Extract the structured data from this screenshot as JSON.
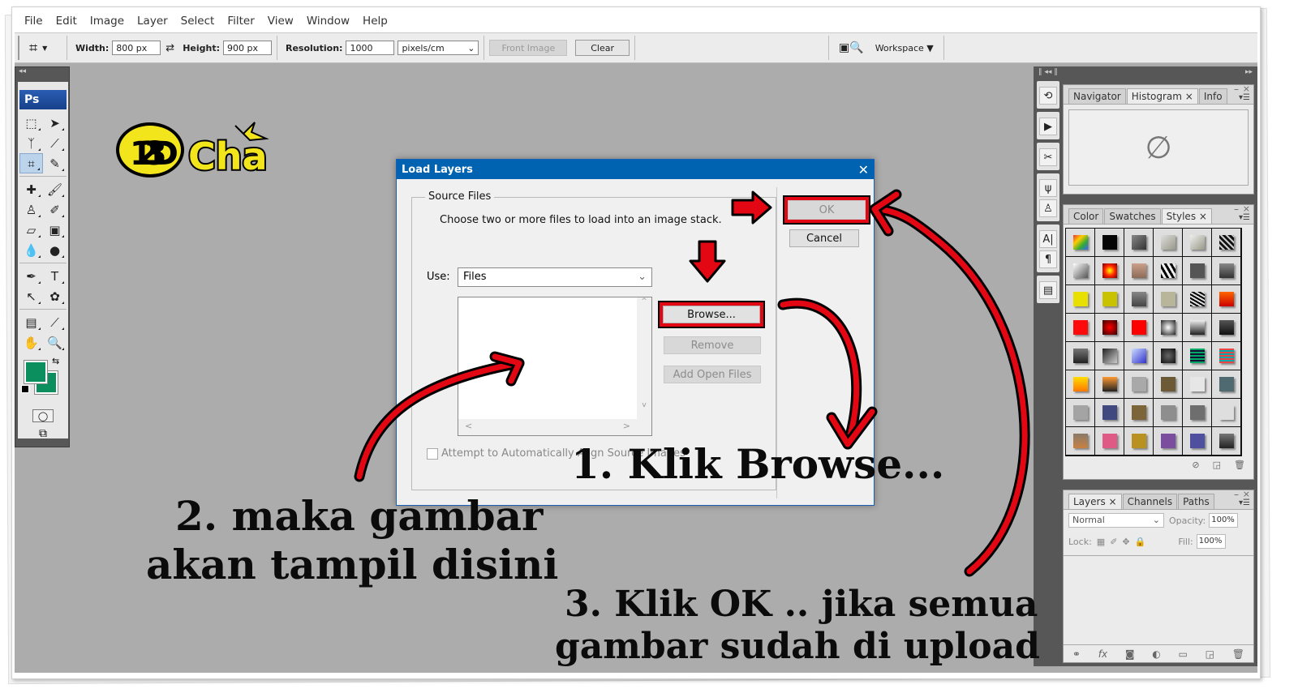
{
  "menubar": {
    "items": [
      "File",
      "Edit",
      "Image",
      "Layer",
      "Select",
      "Filter",
      "View",
      "Window",
      "Help"
    ]
  },
  "options_bar": {
    "tool_icon": "crop-icon",
    "width_label": "Width:",
    "width_value": "800 px",
    "swap_icon": "swap-arrows-icon",
    "height_label": "Height:",
    "height_value": "900 px",
    "resolution_label": "Resolution:",
    "resolution_value": "1000",
    "resolution_unit": "pixels/cm",
    "front_image_label": "Front Image",
    "clear_label": "Clear",
    "bridge_icon": "bridge-search-icon",
    "workspace_label": "Workspace ▼"
  },
  "tools_panel": {
    "collapse": "◂◂",
    "logo": "Ps",
    "foreground_color": "#0c8f5e",
    "background_color": "#0c8f5e",
    "tools": [
      {
        "name": "marquee-tool-icon",
        "glyph": "⬚"
      },
      {
        "name": "move-tool-icon",
        "glyph": "➤"
      },
      {
        "name": "lasso-tool-icon",
        "glyph": "ᛉ"
      },
      {
        "name": "quick-selection-tool-icon",
        "glyph": "⟋"
      },
      {
        "name": "crop-tool-icon",
        "glyph": "⌗",
        "active": true
      },
      {
        "name": "eyedropper-slice-tool-icon",
        "glyph": "✎"
      },
      {
        "name": "healing-brush-tool-icon",
        "glyph": "✚"
      },
      {
        "name": "brush-tool-icon",
        "glyph": "🖌"
      },
      {
        "name": "clone-stamp-tool-icon",
        "glyph": "♙"
      },
      {
        "name": "history-brush-tool-icon",
        "glyph": "✐"
      },
      {
        "name": "eraser-tool-icon",
        "glyph": "▱"
      },
      {
        "name": "gradient-tool-icon",
        "glyph": "▣"
      },
      {
        "name": "blur-tool-icon",
        "glyph": "💧"
      },
      {
        "name": "dodge-tool-icon",
        "glyph": "●"
      },
      {
        "name": "pen-tool-icon",
        "glyph": "✒"
      },
      {
        "name": "type-tool-icon",
        "glyph": "T"
      },
      {
        "name": "path-selection-tool-icon",
        "glyph": "↖"
      },
      {
        "name": "custom-shape-tool-icon",
        "glyph": "✿"
      },
      {
        "name": "notes-tool-icon",
        "glyph": "▤"
      },
      {
        "name": "eyedropper-tool-icon",
        "glyph": "⟋"
      },
      {
        "name": "hand-tool-icon",
        "glyph": "✋"
      },
      {
        "name": "zoom-tool-icon",
        "glyph": "🔍"
      }
    ]
  },
  "logo": {
    "text": "Cha",
    "badge": "123D"
  },
  "dialog": {
    "title": "Load Layers",
    "close": "✕",
    "group_label": "Source Files",
    "description": "Choose two or more files to load into an image stack.",
    "use_label": "Use:",
    "use_value": "Files",
    "checkbox_label": "Attempt to Automatically Align Source Images",
    "checkbox_checked": false,
    "buttons": {
      "ok": "OK",
      "cancel": "Cancel",
      "browse": "Browse...",
      "remove": "Remove",
      "add_open_files": "Add Open Files"
    }
  },
  "right_dock": {
    "panel1": {
      "tabs": [
        "Navigator",
        "Histogram ×",
        "Info"
      ],
      "active": 1,
      "empty_glyph": "∅"
    },
    "panel2": {
      "tabs": [
        "Color",
        "Swatches",
        "Styles ×"
      ],
      "active": 2,
      "styles": [
        "linear-gradient(135deg,#e33,#fc0,#3a3,#36f)",
        "#050505",
        "linear-gradient(135deg,#888,#333)",
        "linear-gradient(135deg,#ddd,#998)",
        "linear-gradient(135deg,#eee,#998)",
        "repeating-linear-gradient(45deg,#111 0 3px,#ccc 3px 5px)",
        "linear-gradient(135deg,#fff,#555)",
        "radial-gradient(#ff0,#f20,#700)",
        "linear-gradient(#caa08a,#8d6a58)",
        "repeating-linear-gradient(60deg,#000 0 3px,#eee 3px 6px)",
        "#555555",
        "linear-gradient(#888,#333)",
        "#e8e000",
        "#c9c200",
        "linear-gradient(#888,#444)",
        "#b7b59a",
        "repeating-linear-gradient(30deg,#000 0 2px,#ddd 2px 4px)",
        "linear-gradient(#f60,#c00)",
        "#ff0a0a",
        "radial-gradient(#f00,#300)",
        "#ff0000",
        "radial-gradient(#fff,#222)",
        "linear-gradient(#eee,#222)",
        "linear-gradient(#555,#111)",
        "linear-gradient(#777,#222)",
        "linear-gradient(135deg,#222,#ccc)",
        "linear-gradient(135deg,#cdf,#33c)",
        "radial-gradient(#666,#111)",
        "repeating-linear-gradient(#0a6 0 2px,#113 2px 4px)",
        "repeating-linear-gradient(#e44 0 2px,#0aa 2px 4px)",
        "linear-gradient(#fd0,#f70)",
        "linear-gradient(#f93,#222)",
        "#a9a9a9",
        "#6b5a35",
        "#e6e6e6",
        "#4f6a70",
        "#a4a4a4",
        "#3f4980",
        "#7c6538",
        "#8e8e8e",
        "#6e6e6e",
        "#dedede",
        "linear-gradient(#8a7a6a,#c88040)",
        "#e05a86",
        "#b99121",
        "#7c4d9e",
        "#4f4fa0",
        "linear-gradient(#777,#222)"
      ],
      "footer_icons": [
        "clear-style-icon",
        "new-style-icon",
        "delete-icon"
      ]
    },
    "panel3": {
      "tabs": [
        "Layers ×",
        "Channels",
        "Paths"
      ],
      "active": 0,
      "blend_mode": "Normal",
      "opacity_label": "Opacity:",
      "opacity_value": "100%",
      "lock_label": "Lock:",
      "fill_label": "Fill:",
      "fill_value": "100%",
      "footer_icons": [
        "link-icon",
        "fx-icon",
        "mask-icon",
        "adjustment-icon",
        "folder-icon",
        "new-layer-icon",
        "trash-icon"
      ]
    }
  },
  "annotations": {
    "step1": "1. Klik Browse...",
    "step2_line1": "2. maka gambar",
    "step2_line2": "akan tampil disini",
    "step3_line1": "3. Klik OK .. jika semua",
    "step3_line2": "gambar sudah di upload",
    "arrow_color": "#e30613"
  }
}
